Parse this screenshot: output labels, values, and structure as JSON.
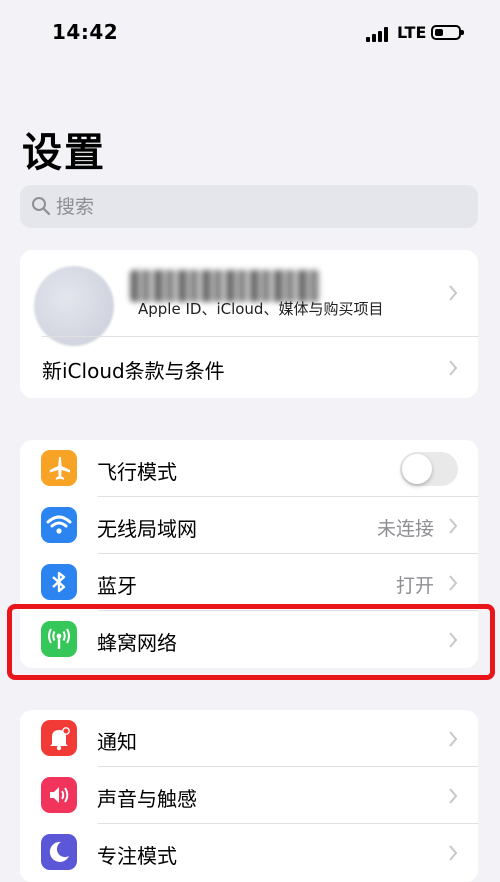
{
  "status_bar": {
    "time": "14:42",
    "network": "LTE",
    "battery_level": 0.35
  },
  "title": "设置",
  "search": {
    "placeholder": "搜索"
  },
  "profile": {
    "subtitle": "Apple ID、iCloud、媒体与购买项目"
  },
  "icloud_terms": {
    "label": "新iCloud条款与条件"
  },
  "connectivity": [
    {
      "label": "飞行模式",
      "icon": "airplane-icon",
      "color": "#f7a325",
      "toggle": false
    },
    {
      "label": "无线局域网",
      "icon": "wifi-icon",
      "color": "#2b84f0",
      "value": "未连接"
    },
    {
      "label": "蓝牙",
      "icon": "bluetooth-icon",
      "color": "#2b84f0",
      "value": "打开"
    },
    {
      "label": "蜂窝网络",
      "icon": "cellular-antenna-icon",
      "color": "#35c759",
      "highlighted": true
    }
  ],
  "notifications": [
    {
      "label": "通知",
      "icon": "notification-bell-icon",
      "color": "#f23b36"
    },
    {
      "label": "声音与触感",
      "icon": "speaker-icon",
      "color": "#f0345b"
    },
    {
      "label": "专注模式",
      "icon": "moon-icon",
      "color": "#5c57d6"
    }
  ],
  "colors": {
    "highlight": "#e8161b",
    "background": "#f2f2f7"
  }
}
